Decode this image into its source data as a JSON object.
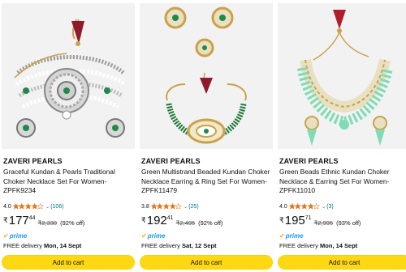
{
  "colors": {
    "link": "#007185",
    "star": "#de7921",
    "prime": "#1a98ff",
    "button": "#ffd814",
    "image_bg": "#f2f2f2"
  },
  "products": [
    {
      "brand": "ZAVERI PEARLS",
      "title": "Graceful Kundan & Pearls Traditional Choker Necklace Set For Women-ZPFK9234",
      "rating": "4.0",
      "rating_value": 4.0,
      "reviews": "(106)",
      "currency": "₹",
      "price_whole": "177",
      "price_frac": "44",
      "mrp": "₹2,330",
      "discount": "(92% off)",
      "prime": "prime",
      "delivery_label": "FREE delivery",
      "delivery_date": "Mon, 14 Sept",
      "button": "Add to cart",
      "image_icon": "kundan-choker-image"
    },
    {
      "brand": "ZAVERI PEARLS",
      "title": "Green Multistrand Beaded Kundan Choker Necklace Earring & Ring Set For Women-ZPFK11479",
      "rating": "3.8",
      "rating_value": 3.8,
      "reviews": "(25)",
      "currency": "₹",
      "price_whole": "192",
      "price_frac": "41",
      "mrp": "₹2,495",
      "discount": "(92% off)",
      "prime": "prime",
      "delivery_label": "FREE delivery",
      "delivery_date": "Sat, 12 Sept",
      "button": "Add to cart",
      "image_icon": "green-choker-set-image"
    },
    {
      "brand": "ZAVERI PEARLS",
      "title": "Green Beads Ethnic Kundan Choker Necklace & Earring Set For Women-ZPFK11010",
      "rating": "4.0",
      "rating_value": 4.0,
      "reviews": "(3)",
      "currency": "₹",
      "price_whole": "195",
      "price_frac": "71",
      "mrp": "₹2,995",
      "discount": "(93% off)",
      "prime": "prime",
      "delivery_label": "FREE delivery",
      "delivery_date": "Mon, 14 Sept",
      "button": "Add to cart",
      "image_icon": "green-beads-necklace-image"
    }
  ]
}
